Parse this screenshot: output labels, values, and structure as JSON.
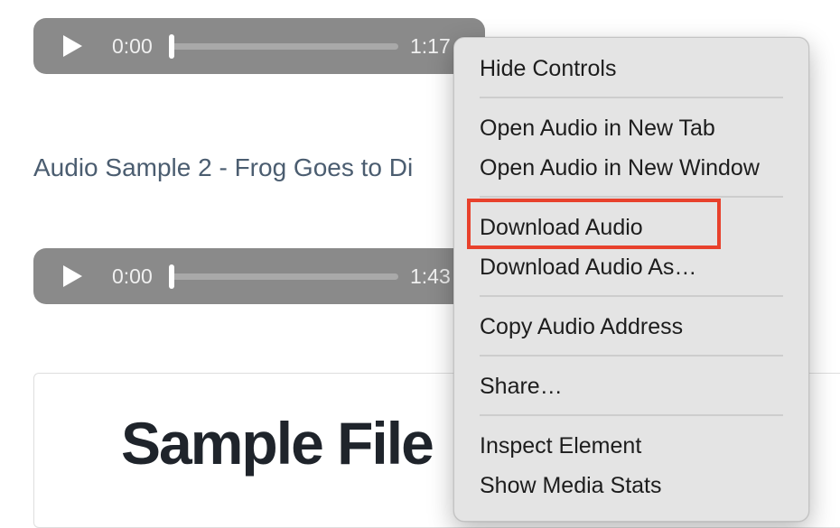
{
  "players": [
    {
      "current_time": "0:00",
      "duration": "1:17",
      "progress": 0.0
    },
    {
      "current_time": "0:00",
      "duration": "1:43",
      "progress": 0.0
    }
  ],
  "heading": "Audio Sample 2 - Frog Goes to Di",
  "card": {
    "title": "Sample File"
  },
  "context_menu": {
    "items": [
      "Hide Controls",
      "Open Audio in New Tab",
      "Open Audio in New Window",
      "Download Audio",
      "Download Audio As…",
      "Copy Audio Address",
      "Share…",
      "Inspect Element",
      "Show Media Stats"
    ],
    "highlighted": "Download Audio"
  },
  "colors": {
    "player_bg": "#8a8a8a",
    "heading": "#4b5d70",
    "menu_bg": "#e4e4e4",
    "highlight": "#e8412c"
  },
  "icons": {
    "play": "play-icon"
  }
}
